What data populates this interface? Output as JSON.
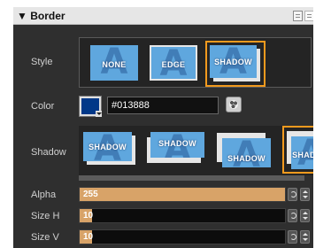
{
  "section": {
    "arrow": "▼",
    "title": "Border",
    "copy_icon": "copy-icon",
    "paste_icon": "paste-icon"
  },
  "style": {
    "label": "Style",
    "options": [
      "NONE",
      "EDGE",
      "SHADOW"
    ],
    "selected": "SHADOW"
  },
  "color": {
    "label": "Color",
    "swatch": "#013888",
    "hex": "#013888",
    "picker_icon": "palette-icon"
  },
  "shadow": {
    "label": "Shadow",
    "options": [
      "SHADOW",
      "SHADOW",
      "SHADOW",
      "SHADOW"
    ],
    "selected_index": 3
  },
  "alpha": {
    "label": "Alpha",
    "value": "255",
    "fraction": 1.0
  },
  "size_h": {
    "label": "Size H",
    "value": "10",
    "fraction": 0.06
  },
  "size_v": {
    "label": "Size V",
    "value": "10",
    "fraction": 0.06
  }
}
